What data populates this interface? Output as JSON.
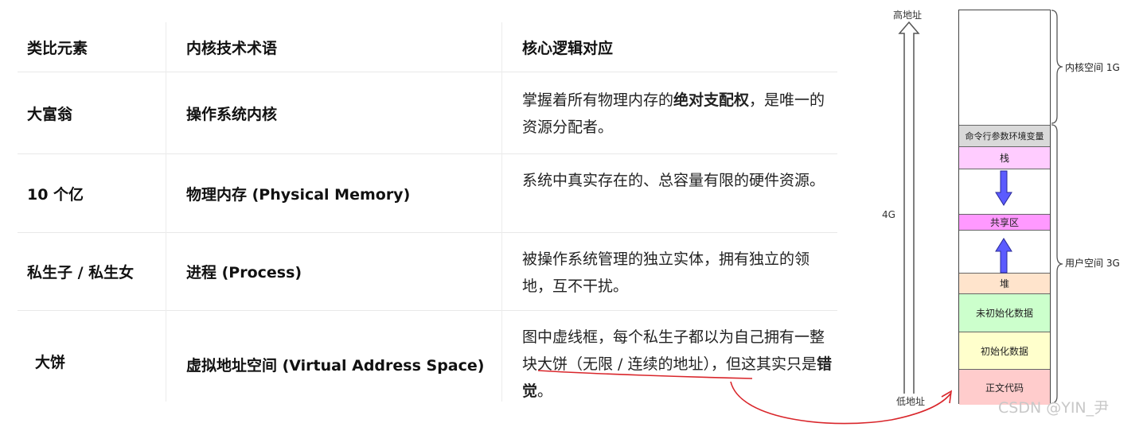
{
  "table": {
    "headers": [
      "类比元素",
      "内核技术术语",
      "核心逻辑对应"
    ],
    "rows": [
      {
        "analogy": "大富翁",
        "term": "操作系统内核",
        "logic_pre": "掌握着所有物理内存的",
        "logic_bold": "绝对支配权",
        "logic_post": "，是唯一的资源分配者。"
      },
      {
        "analogy": "10 个亿",
        "term": "物理内存 (Physical Memory)",
        "logic_pre": "系统中真实存在的、总容量有限的硬件资源。",
        "logic_bold": "",
        "logic_post": ""
      },
      {
        "analogy": "私生子 / 私生女",
        "term": "进程 (Process)",
        "logic_pre": "被操作系统管理的独立实体，拥有独立的领地，互不干扰。",
        "logic_bold": "",
        "logic_post": ""
      },
      {
        "analogy": "大饼",
        "term": "虚拟地址空间 (Virtual Address Space)",
        "logic_pre": "图中虚线框，每个私生子都以为自己拥有一整块大饼（无限 / 连续的地址），但这其实只是",
        "logic_bold": "错觉",
        "logic_post": "。"
      }
    ]
  },
  "diagram": {
    "high_addr": "高地址",
    "low_addr": "低地址",
    "total": "4G",
    "kernel_space": "内核空间 1G",
    "user_space": "用户空间 3G",
    "segments": [
      {
        "label": "命令行参数环境变量",
        "color": "#d9d9d9"
      },
      {
        "label": "栈",
        "color": "#ffccff"
      },
      {
        "label": "",
        "color": "#ffffff"
      },
      {
        "label": "共享区",
        "color": "#ff99ff"
      },
      {
        "label": "",
        "color": "#ffffff"
      },
      {
        "label": "堆",
        "color": "#ffe4cc"
      },
      {
        "label": "未初始化数据",
        "color": "#ccffcc"
      },
      {
        "label": "初始化数据",
        "color": "#ffffcc"
      },
      {
        "label": "正文代码",
        "color": "#ffcccc"
      }
    ],
    "arrow_color": "#5b5bff"
  },
  "watermark": "CSDN @YIN_尹"
}
